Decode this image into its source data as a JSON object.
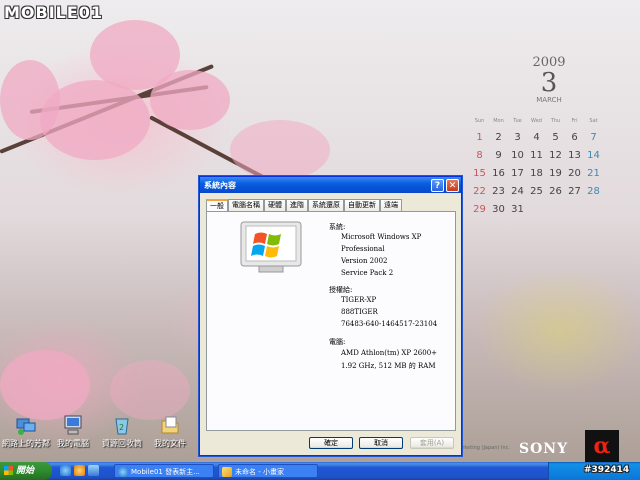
{
  "watermark": {
    "logo": "MOBILE01",
    "post_id": "#392414"
  },
  "calendar": {
    "year": "2009",
    "month_number": "3",
    "month_name": "MARCH",
    "weekdays": [
      "Sun",
      "Mon",
      "Tue",
      "Wed",
      "Thu",
      "Fri",
      "Sat"
    ],
    "weeks": [
      [
        "1",
        "2",
        "3",
        "4",
        "5",
        "6",
        "7"
      ],
      [
        "8",
        "9",
        "10",
        "11",
        "12",
        "13",
        "14"
      ],
      [
        "15",
        "16",
        "17",
        "18",
        "19",
        "20",
        "21"
      ],
      [
        "22",
        "23",
        "24",
        "25",
        "26",
        "27",
        "28"
      ],
      [
        "29",
        "30",
        "31",
        "",
        "",
        "",
        ""
      ]
    ]
  },
  "desktop_icons": [
    {
      "label": "網路上的芳鄰",
      "icon": "network-places-icon"
    },
    {
      "label": "我的電腦",
      "icon": "my-computer-icon"
    },
    {
      "label": "資源回收筒",
      "icon": "recycle-bin-icon"
    },
    {
      "label": "我的文件",
      "icon": "my-documents-icon"
    }
  ],
  "brand": {
    "sony": "SONY",
    "alpha": "α",
    "marketing": "Marketing (Japan) Inc."
  },
  "dialog": {
    "title": "系統內容",
    "help_button": "?",
    "close_button": "✕",
    "tabs": [
      "一般",
      "電腦名稱",
      "硬體",
      "進階",
      "系統還原",
      "自動更新",
      "遠端"
    ],
    "active_tab": "一般",
    "system_label": "系統:",
    "system_lines": [
      "Microsoft Windows XP",
      "Professional",
      "Version 2002",
      "Service Pack 2"
    ],
    "registered_label": "授權給:",
    "registered_lines": [
      "TIGER-XP",
      "888TIGER",
      "76483-640-1464517-23104"
    ],
    "computer_label": "電腦:",
    "computer_lines": [
      "AMD Athlon(tm) XP 2600+",
      "1.92 GHz, 512 MB 的 RAM"
    ],
    "ok_button": "確定",
    "cancel_button": "取消",
    "apply_button": "套用(A)"
  },
  "taskbar": {
    "start_label": "開始",
    "tasks": [
      {
        "label": "Mobile01 發表新主...",
        "icon": "browser-icon"
      },
      {
        "label": "未命名 - 小畫家",
        "icon": "paint-icon"
      }
    ]
  },
  "colors": {
    "titlebar": "#0a5ee0",
    "dialog_bg": "#ece9d8",
    "taskbar": "#245edb",
    "start": "#2e8b2e"
  }
}
